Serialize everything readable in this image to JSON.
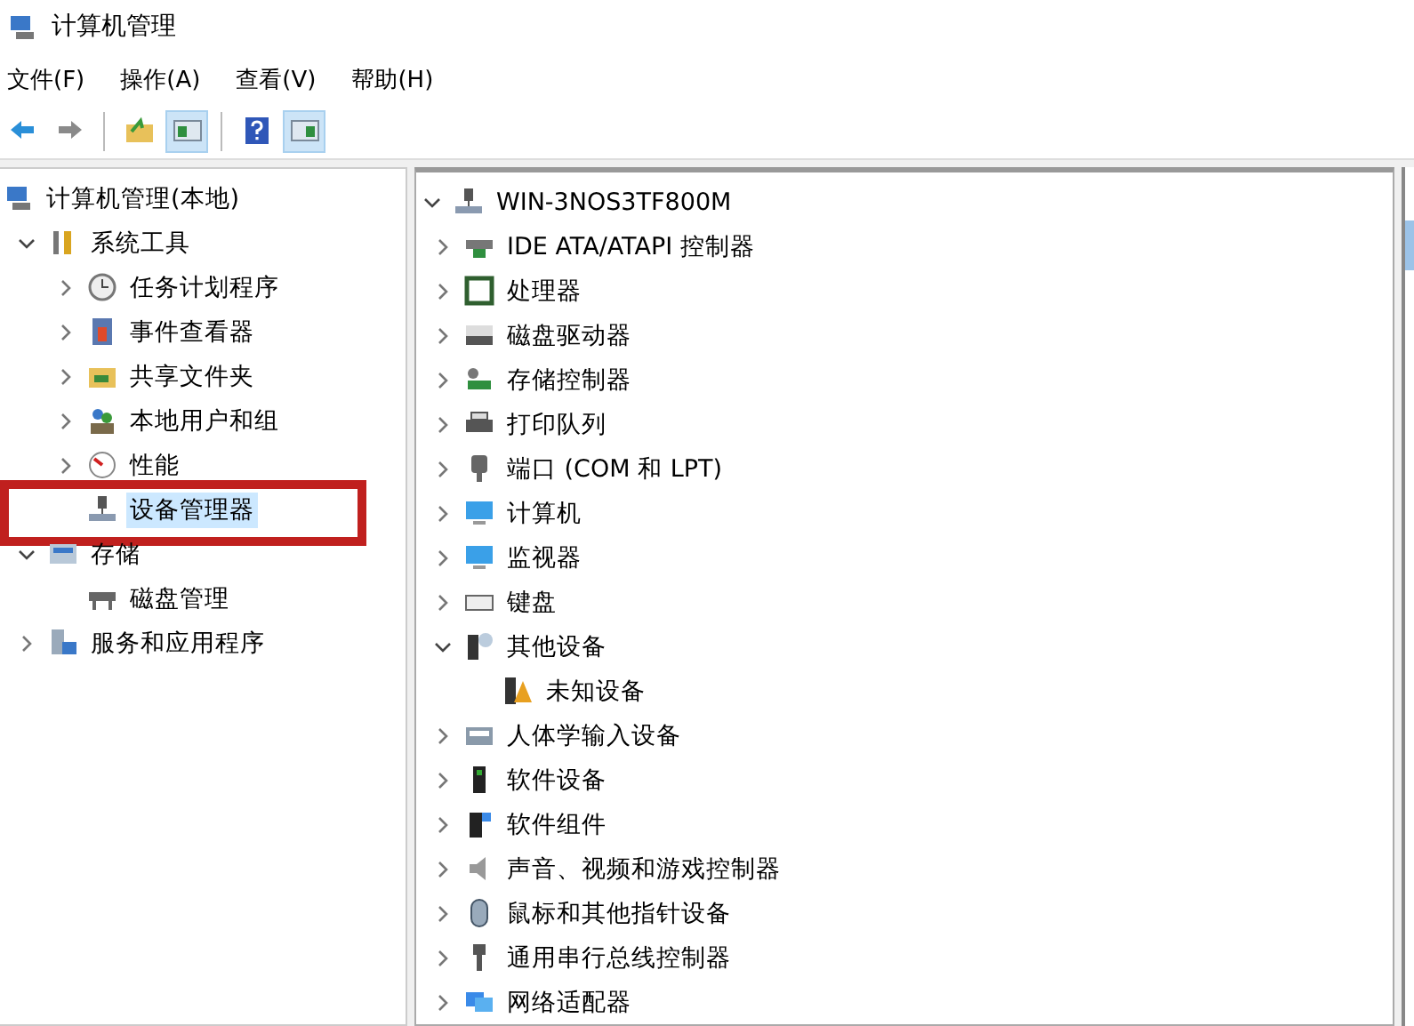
{
  "window": {
    "title": "计算机管理"
  },
  "menu": [
    "文件(F)",
    "操作(A)",
    "查看(V)",
    "帮助(H)"
  ],
  "toolbar": [
    {
      "kind": "back",
      "on": false
    },
    {
      "kind": "forward",
      "on": false
    },
    {
      "kind": "up",
      "on": false
    },
    {
      "kind": "tree-toggle",
      "on": true
    },
    {
      "kind": "help",
      "on": false
    },
    {
      "kind": "action-toggle",
      "on": true
    }
  ],
  "left_tree": [
    {
      "label": "计算机管理(本地)",
      "kind": "mgmt",
      "selected": false,
      "highlighted": false,
      "children": [
        {
          "label": "系统工具",
          "kind": "tools",
          "expanded": true,
          "selected": false,
          "highlighted": false,
          "children": [
            {
              "label": "任务计划程序",
              "kind": "clock",
              "expanded": false,
              "selected": false,
              "highlighted": false
            },
            {
              "label": "事件查看器",
              "kind": "event",
              "expanded": false,
              "selected": false,
              "highlighted": false
            },
            {
              "label": "共享文件夹",
              "kind": "share",
              "expanded": false,
              "selected": false,
              "highlighted": false
            },
            {
              "label": "本地用户和组",
              "kind": "users",
              "expanded": false,
              "selected": false,
              "highlighted": false
            },
            {
              "label": "性能",
              "kind": "perf",
              "expanded": false,
              "selected": false,
              "highlighted": false
            },
            {
              "label": "设备管理器",
              "kind": "devmgr",
              "selected": true,
              "highlighted": true
            }
          ]
        },
        {
          "label": "存储",
          "kind": "storage",
          "expanded": true,
          "selected": false,
          "highlighted": false,
          "children": [
            {
              "label": "磁盘管理",
              "kind": "disk",
              "selected": false,
              "highlighted": false
            }
          ]
        },
        {
          "label": "服务和应用程序",
          "kind": "services",
          "expanded": false,
          "selected": false,
          "highlighted": false
        }
      ]
    }
  ],
  "device_tree": [
    {
      "label": "WIN-3NOS3TF800M",
      "kind": "devmgr",
      "expanded": true,
      "children": [
        {
          "label": "IDE ATA/ATAPI 控制器",
          "kind": "ide",
          "expanded": false
        },
        {
          "label": "处理器",
          "kind": "cpu",
          "expanded": false
        },
        {
          "label": "磁盘驱动器",
          "kind": "drive",
          "expanded": false
        },
        {
          "label": "存储控制器",
          "kind": "storctl",
          "expanded": false
        },
        {
          "label": "打印队列",
          "kind": "printer",
          "expanded": false
        },
        {
          "label": "端口 (COM 和 LPT)",
          "kind": "port",
          "expanded": false
        },
        {
          "label": "计算机",
          "kind": "monitor",
          "expanded": false
        },
        {
          "label": "监视器",
          "kind": "monitor",
          "expanded": false
        },
        {
          "label": "键盘",
          "kind": "keyboard",
          "expanded": false
        },
        {
          "label": "其他设备",
          "kind": "other",
          "expanded": true,
          "children": [
            {
              "label": "未知设备",
              "kind": "unknown"
            }
          ]
        },
        {
          "label": "人体学输入设备",
          "kind": "hid",
          "expanded": false
        },
        {
          "label": "软件设备",
          "kind": "swdev",
          "expanded": false
        },
        {
          "label": "软件组件",
          "kind": "swcomp",
          "expanded": false
        },
        {
          "label": "声音、视频和游戏控制器",
          "kind": "sound",
          "expanded": false
        },
        {
          "label": "鼠标和其他指针设备",
          "kind": "mouse",
          "expanded": false
        },
        {
          "label": "通用串行总线控制器",
          "kind": "usb",
          "expanded": false
        },
        {
          "label": "网络适配器",
          "kind": "network",
          "expanded": false
        }
      ]
    }
  ]
}
